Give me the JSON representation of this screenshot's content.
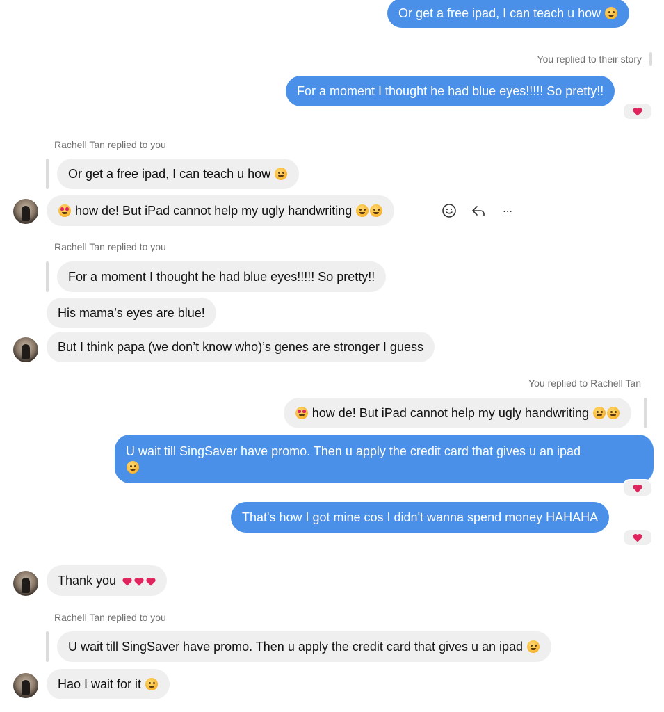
{
  "colors": {
    "outgoing_bubble": "#4a8fe8",
    "incoming_bubble": "#efefef",
    "meta_text": "#707070",
    "heart": "#e0245e"
  },
  "messages": {
    "m1": "Or get a free ipad, I can teach u how",
    "story_note": "You replied to their story",
    "m2": "For a moment I thought he had blue eyes!!!!! So pretty!!",
    "reply_note_1": "Rachell Tan replied to you",
    "quote_1": "Or get a free ipad, I can teach u how",
    "m3": "how de! But iPad cannot help my ugly handwriting",
    "reply_note_2": "Rachell Tan replied to you",
    "quote_2": "For a moment I thought he had blue eyes!!!!! So pretty!!",
    "m4": "His mama’s eyes are blue!",
    "m5": "But I think papa (we don’t know who)’s genes are stronger I guess",
    "reply_note_3": "You replied to Rachell Tan",
    "quote_3": "how de! But iPad cannot help my ugly handwriting",
    "m6": "U wait till SingSaver have promo. Then u apply the credit card that gives u an ipad",
    "m7": "That's how I got mine cos I didn't wanna spend money HAHAHA",
    "m8": "Thank you",
    "reply_note_4": "Rachell Tan replied to you",
    "quote_4": "U wait till SingSaver have promo. Then u apply the credit card that gives u an ipad",
    "m9": "Hao I wait for it"
  },
  "hover_actions": {
    "react": "smiley-icon",
    "reply": "reply-arrow-icon",
    "more": "more-dots-icon"
  },
  "more_glyph": "···"
}
